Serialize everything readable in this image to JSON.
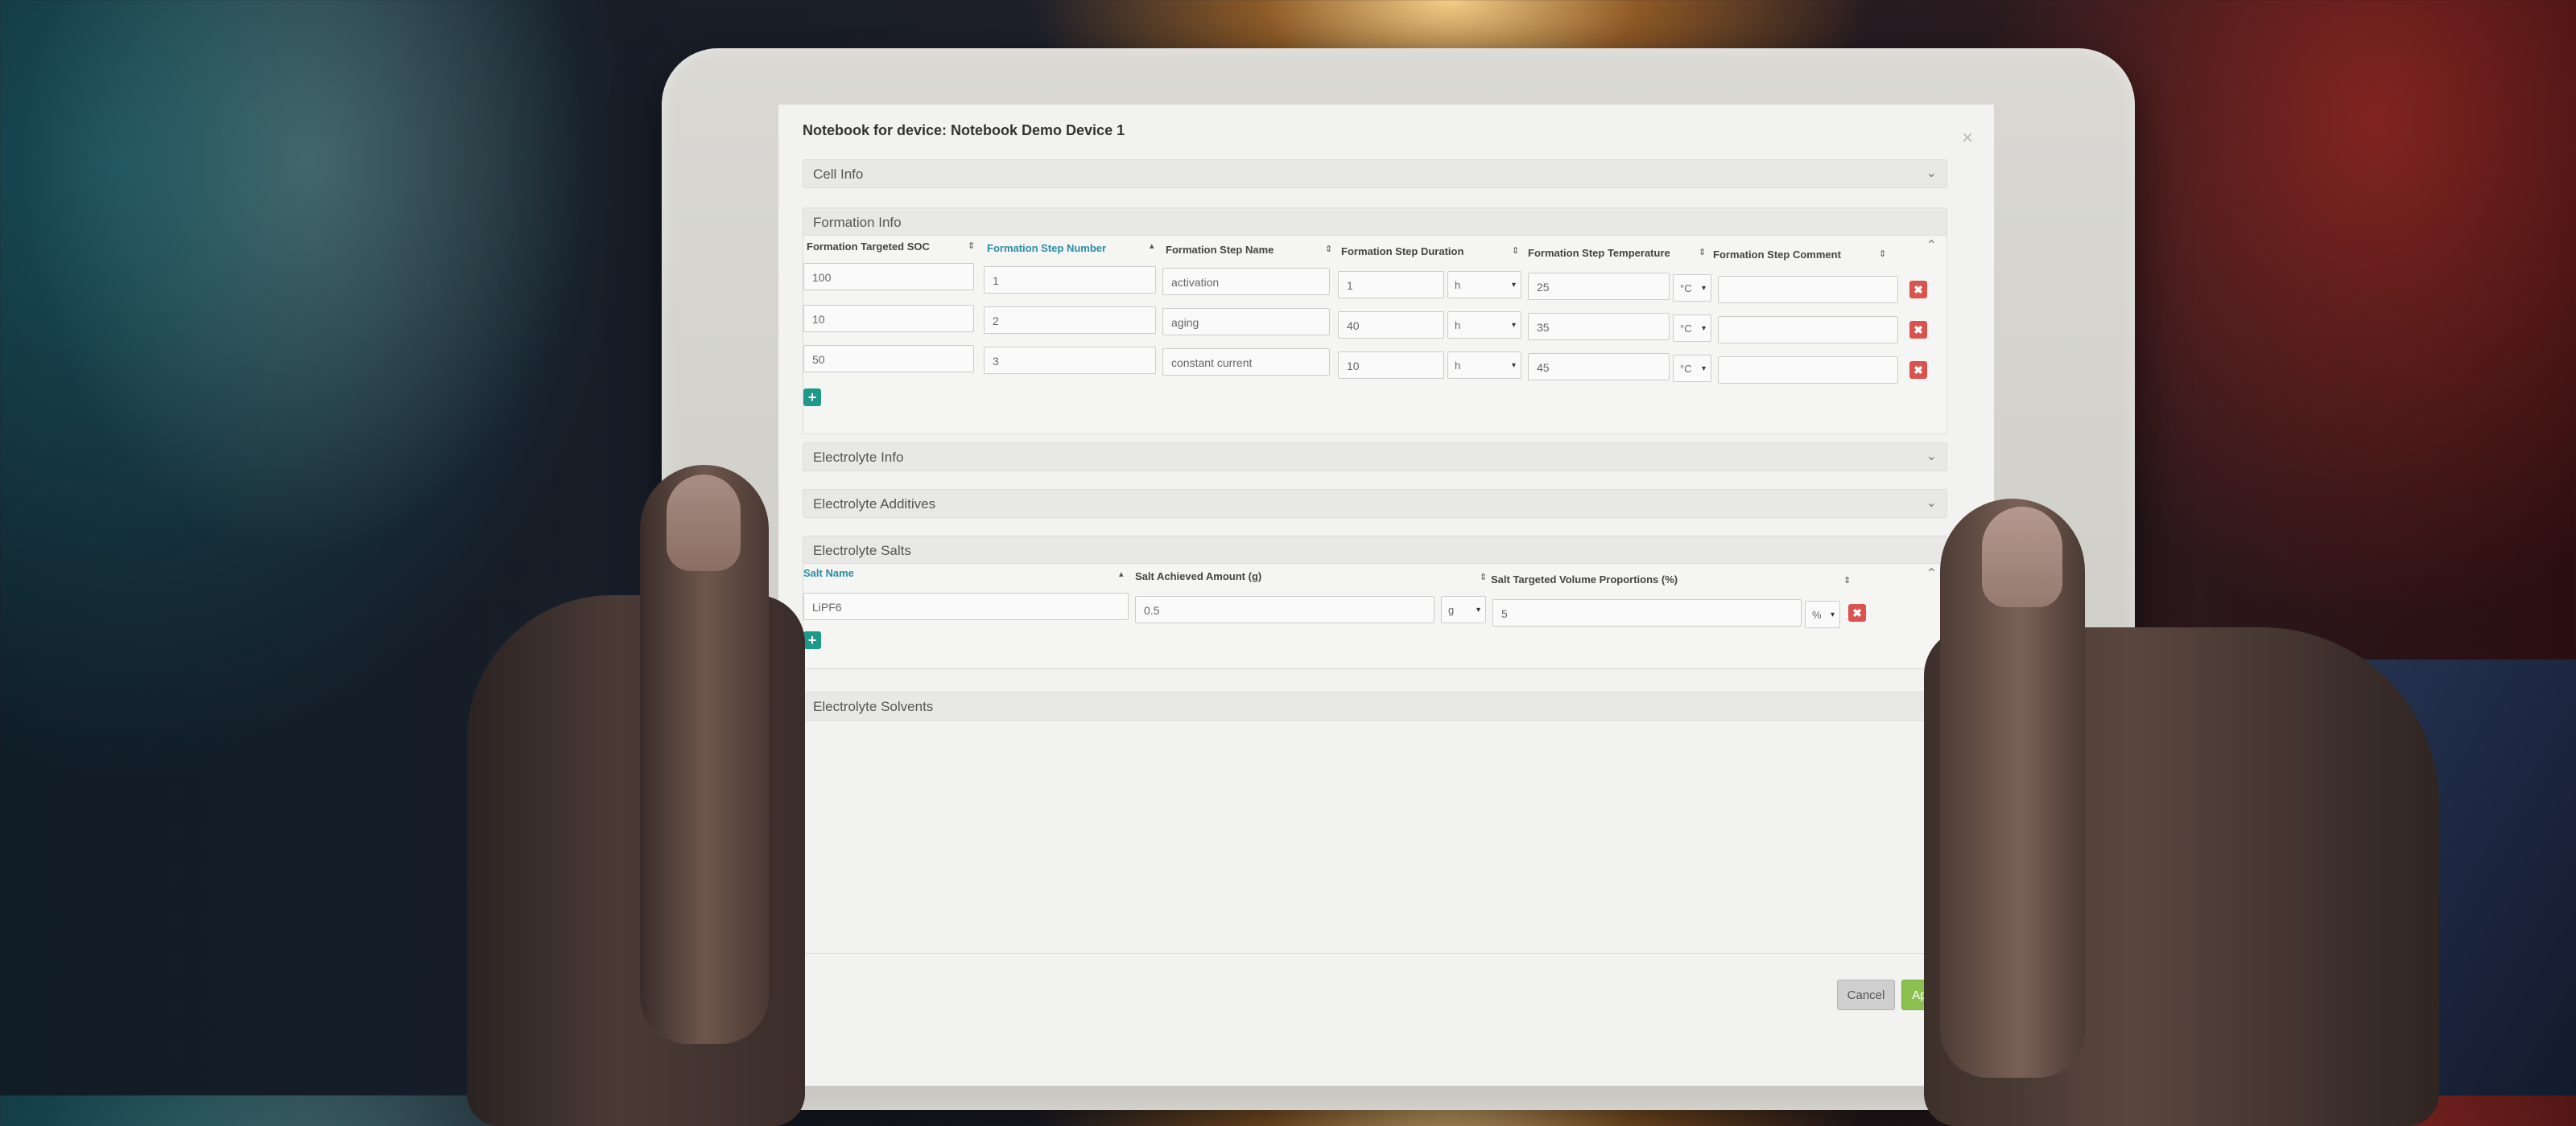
{
  "modal": {
    "title": "Notebook for device: Notebook Demo Device 1",
    "close_icon": "close-icon"
  },
  "sections": {
    "cell_info": "Cell Info",
    "formation_info": "Formation Info",
    "electrolyte_info": "Electrolyte Info",
    "electrolyte_additives": "Electrolyte Additives",
    "electrolyte_salts": "Electrolyte Salts",
    "electrolyte_solvents": "Electrolyte Solvents"
  },
  "formation": {
    "headers": {
      "soc": "Formation Targeted SOC",
      "step_number": "Formation Step Number",
      "step_name": "Formation Step Name",
      "duration": "Formation Step Duration",
      "temperature": "Formation Step Temperature",
      "comment": "Formation Step Comment"
    },
    "rows": [
      {
        "soc": "100",
        "step": "1",
        "name": "activation",
        "duration": "1",
        "duration_unit": "h",
        "temp": "25",
        "temp_unit": "°C",
        "comment": ""
      },
      {
        "soc": "10",
        "step": "2",
        "name": "aging",
        "duration": "40",
        "duration_unit": "h",
        "temp": "35",
        "temp_unit": "°C",
        "comment": ""
      },
      {
        "soc": "50",
        "step": "3",
        "name": "constant current",
        "duration": "10",
        "duration_unit": "h",
        "temp": "45",
        "temp_unit": "°C",
        "comment": ""
      }
    ]
  },
  "salts": {
    "headers": {
      "name": "Salt Name",
      "amount": "Salt Achieved Amount (g)",
      "proportion": "Salt Targeted Volume Proportions (%)"
    },
    "rows": [
      {
        "name": "LiPF6",
        "amount": "0.5",
        "amount_unit": "g",
        "proportion": "5",
        "proportion_unit": "%"
      }
    ]
  },
  "footer": {
    "cancel": "Cancel",
    "apply": "Apply"
  },
  "colors": {
    "accent": "#2b8ea3",
    "delete": "#d9534f",
    "add": "#1f9a8a",
    "apply": "#8cc152"
  }
}
